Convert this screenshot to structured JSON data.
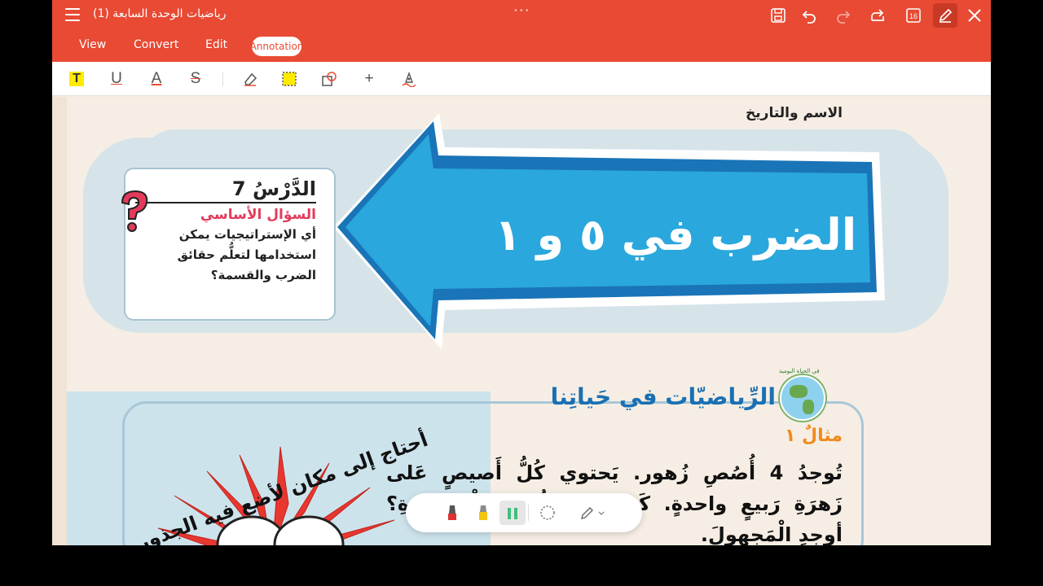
{
  "app": {
    "doc_title": "رياضيات الوحدة السابعة (1)",
    "page_count_badge": "16",
    "accent_color": "#e84a33"
  },
  "titlebar": {
    "icons": [
      "menu-icon",
      "save-icon",
      "undo-icon",
      "redo-icon",
      "share-icon",
      "page-count-icon",
      "edit-pen-icon",
      "close-icon"
    ]
  },
  "tabs": [
    {
      "label": "View"
    },
    {
      "label": "Convert"
    },
    {
      "label": "Edit"
    },
    {
      "label": "Annotation",
      "active": true
    }
  ],
  "annotation_tools": [
    {
      "name": "highlight-text",
      "glyph": "T"
    },
    {
      "name": "underline",
      "glyph": "U"
    },
    {
      "name": "text-color",
      "glyph": "A"
    },
    {
      "name": "strikethrough",
      "glyph": "S"
    },
    {
      "name": "eraser",
      "glyph": ""
    },
    {
      "name": "area-highlight",
      "glyph": ""
    },
    {
      "name": "shapes",
      "glyph": ""
    },
    {
      "name": "add",
      "glyph": "+"
    },
    {
      "name": "signature",
      "glyph": ""
    }
  ],
  "page": {
    "name_date": "الاسم والتاريخ",
    "lesson_number": "الدَّرْسُ 7",
    "essential_question_label": "السؤال الأساسي",
    "essential_question_text": "أي الإستراتيجيات يمكن استخدامها لتعلُّم حقائق الضرب والقسمة؟",
    "lesson_title": "الضرب في ٥ و ١",
    "section_title": "الرِّياضيّات في حَياتِنا",
    "globe_label": "في الحياة اليومية",
    "example_label": "مثالٌ ١",
    "example_text": "تُوجدُ 4 أُصُصِ زُهور. يَحتوي كُلُّ أَصيصٍ عَلى زَهرَةِ رَبيعٍ واحدةٍ. كَمْ عَدَدُ الزُّهورِ الْمَوجودَةِ؟ أوجِدِ الْمَجهولَ.",
    "quote": "أحتاج إلى مكان لأضع فيه الجذور"
  },
  "pen_bar": {
    "tools": [
      "red-pen",
      "yellow-highlighter",
      "green-highlighter",
      "lasso",
      "pen-settings"
    ],
    "colors": {
      "red": "#e03131",
      "yellow": "#f2c511",
      "green": "#3fbf7f"
    }
  }
}
